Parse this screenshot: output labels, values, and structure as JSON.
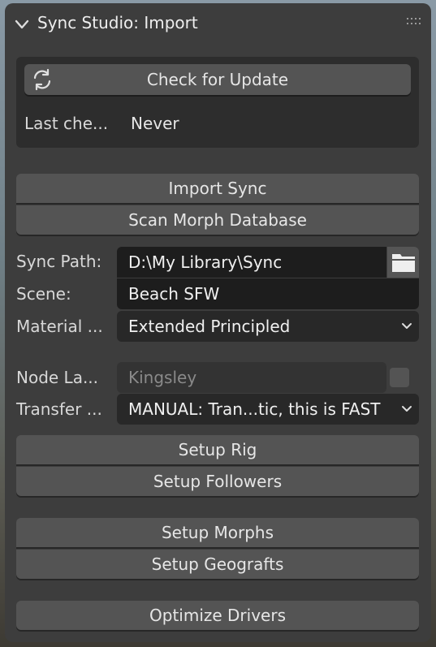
{
  "panel": {
    "title": "Sync Studio: Import",
    "icons": {
      "collapse": "chevron-down-icon",
      "drag": "drag-grip-icon"
    }
  },
  "update": {
    "button_label": "Check for Update",
    "icon": "refresh-icon",
    "last_checked_label": "Last che...",
    "last_checked_value": "Never"
  },
  "actions_1": {
    "import_sync": "Import Sync",
    "scan_morph_db": "Scan Morph Database"
  },
  "settings": {
    "sync_path_label": "Sync Path:",
    "sync_path_value": "D:\\My Library\\Sync",
    "folder_icon": "folder-icon",
    "scene_label": "Scene:",
    "scene_value": "Beach SFW",
    "material_label": "Material ...",
    "material_value": "Extended Principled",
    "node_label": "Node La...",
    "node_value": "Kingsley",
    "transfer_label": "Transfer ...",
    "transfer_value": "MANUAL: Tran...tic, this is FAST"
  },
  "actions_2": {
    "setup_rig": "Setup Rig",
    "setup_followers": "Setup Followers"
  },
  "actions_3": {
    "setup_morphs": "Setup Morphs",
    "setup_geografts": "Setup Geografts"
  },
  "actions_4": {
    "optimize_drivers": "Optimize Drivers"
  }
}
